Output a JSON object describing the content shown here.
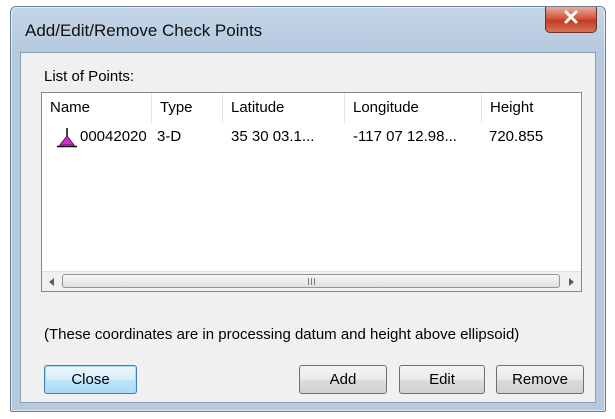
{
  "window": {
    "title": "Add/Edit/Remove Check Points",
    "close_glyph": "X"
  },
  "list": {
    "caption": "List of Points:",
    "columns": [
      "Name",
      "Type",
      "Latitude",
      "Longitude",
      "Height"
    ],
    "rows": [
      {
        "icon": "check-point-icon",
        "name": "00042020",
        "type": "3-D",
        "latitude": "35 30 03.1...",
        "longitude": "-117 07 12.98...",
        "height": "720.855"
      }
    ]
  },
  "scrollbar": {
    "left_arrow": "◂",
    "right_arrow": "▸"
  },
  "note": "(These coordinates are in processing datum and height above ellipsoid)",
  "buttons": {
    "close": "Close",
    "add": "Add",
    "edit": "Edit",
    "remove": "Remove"
  },
  "colors": {
    "icon_fill": "#cc33cc",
    "title_close_button": "#c8472b"
  }
}
